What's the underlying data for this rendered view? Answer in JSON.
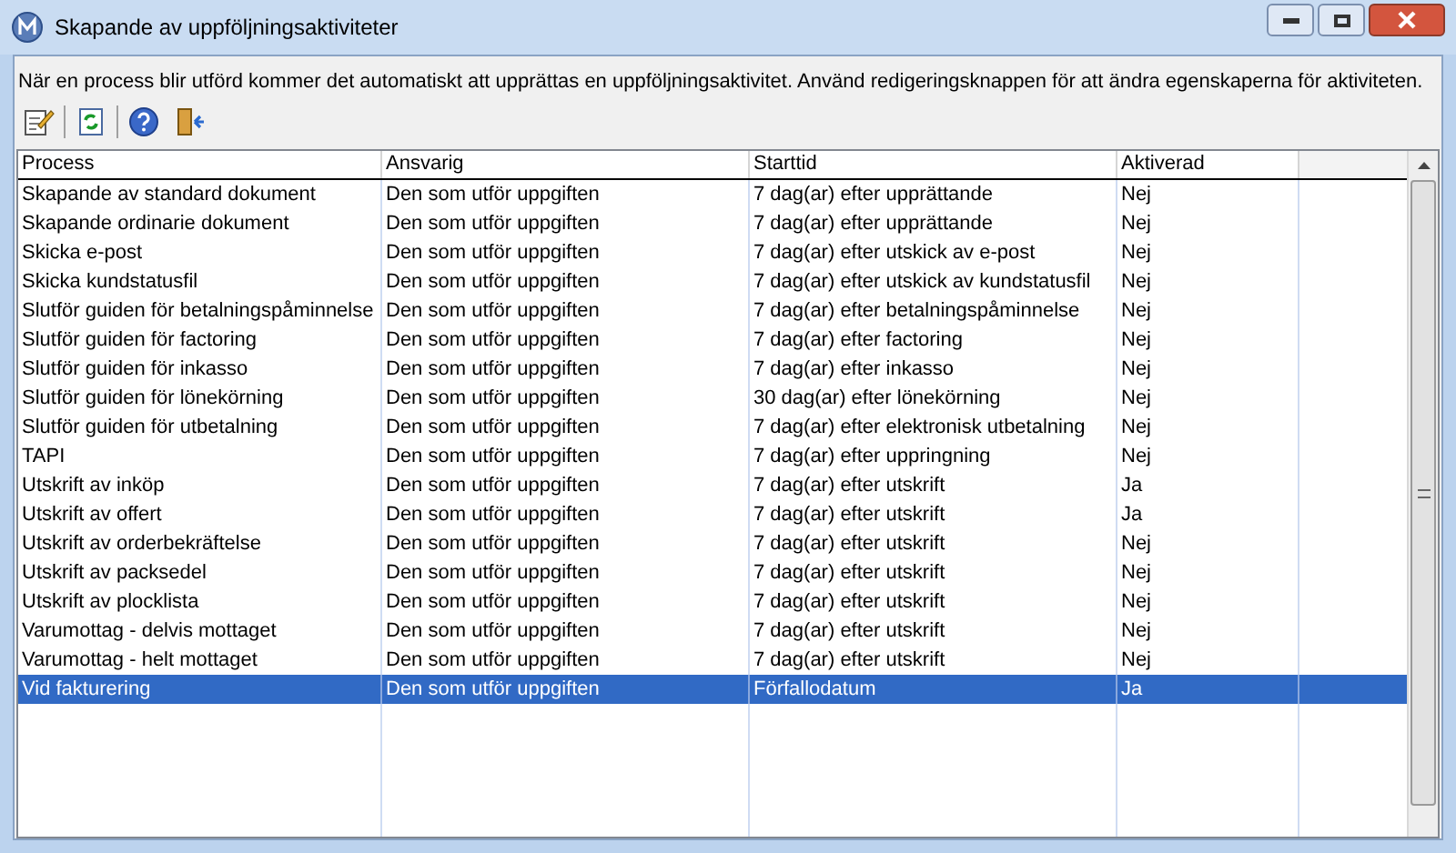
{
  "window": {
    "title": "Skapande av uppföljningsaktiviteter"
  },
  "description": "När en process blir utförd kommer det automatiskt att upprättas en uppföljningsaktivitet. Använd redigeringsknappen för att ändra egenskaperna för aktiviteten.",
  "table": {
    "columns": [
      "Process",
      "Ansvarig",
      "Starttid",
      "Aktiverad"
    ],
    "rows": [
      {
        "cells": [
          "Skapande av standard dokument",
          "Den som utför uppgiften",
          "7 dag(ar) efter upprättande",
          "Nej"
        ],
        "selected": false
      },
      {
        "cells": [
          "Skapande ordinarie dokument",
          "Den som utför uppgiften",
          "7 dag(ar) efter upprättande",
          "Nej"
        ],
        "selected": false
      },
      {
        "cells": [
          "Skicka e-post",
          "Den som utför uppgiften",
          "7 dag(ar) efter utskick av e-post",
          "Nej"
        ],
        "selected": false
      },
      {
        "cells": [
          "Skicka kundstatusfil",
          "Den som utför uppgiften",
          "7 dag(ar) efter utskick av kundstatusfil",
          "Nej"
        ],
        "selected": false
      },
      {
        "cells": [
          "Slutför guiden för betalningspåminnelse",
          "Den som utför uppgiften",
          "7 dag(ar) efter betalningspåminnelse",
          "Nej"
        ],
        "selected": false
      },
      {
        "cells": [
          "Slutför guiden för factoring",
          "Den som utför uppgiften",
          "7 dag(ar) efter factoring",
          "Nej"
        ],
        "selected": false
      },
      {
        "cells": [
          "Slutför guiden för inkasso",
          "Den som utför uppgiften",
          "7 dag(ar) efter inkasso",
          "Nej"
        ],
        "selected": false
      },
      {
        "cells": [
          "Slutför guiden för lönekörning",
          "Den som utför uppgiften",
          "30 dag(ar) efter lönekörning",
          "Nej"
        ],
        "selected": false
      },
      {
        "cells": [
          "Slutför guiden för utbetalning",
          "Den som utför uppgiften",
          "7 dag(ar) efter elektronisk utbetalning",
          "Nej"
        ],
        "selected": false
      },
      {
        "cells": [
          "TAPI",
          "Den som utför uppgiften",
          "7 dag(ar) efter uppringning",
          "Nej"
        ],
        "selected": false
      },
      {
        "cells": [
          "Utskrift av inköp",
          "Den som utför uppgiften",
          "7 dag(ar) efter utskrift",
          "Ja"
        ],
        "selected": false
      },
      {
        "cells": [
          "Utskrift av offert",
          "Den som utför uppgiften",
          "7 dag(ar) efter utskrift",
          "Ja"
        ],
        "selected": false
      },
      {
        "cells": [
          "Utskrift av orderbekräftelse",
          "Den som utför uppgiften",
          "7 dag(ar) efter utskrift",
          "Nej"
        ],
        "selected": false
      },
      {
        "cells": [
          "Utskrift av packsedel",
          "Den som utför uppgiften",
          "7 dag(ar) efter utskrift",
          "Nej"
        ],
        "selected": false
      },
      {
        "cells": [
          "Utskrift av plocklista",
          "Den som utför uppgiften",
          "7 dag(ar) efter utskrift",
          "Nej"
        ],
        "selected": false
      },
      {
        "cells": [
          "Varumottag - delvis mottaget",
          "Den som utför uppgiften",
          "7 dag(ar) efter utskrift",
          "Nej"
        ],
        "selected": false
      },
      {
        "cells": [
          "Varumottag - helt mottaget",
          "Den som utför uppgiften",
          "7 dag(ar) efter utskrift",
          "Nej"
        ],
        "selected": false
      },
      {
        "cells": [
          "Vid fakturering",
          "Den som utför uppgiften",
          "Förfallodatum",
          "Ja"
        ],
        "selected": true
      }
    ]
  }
}
